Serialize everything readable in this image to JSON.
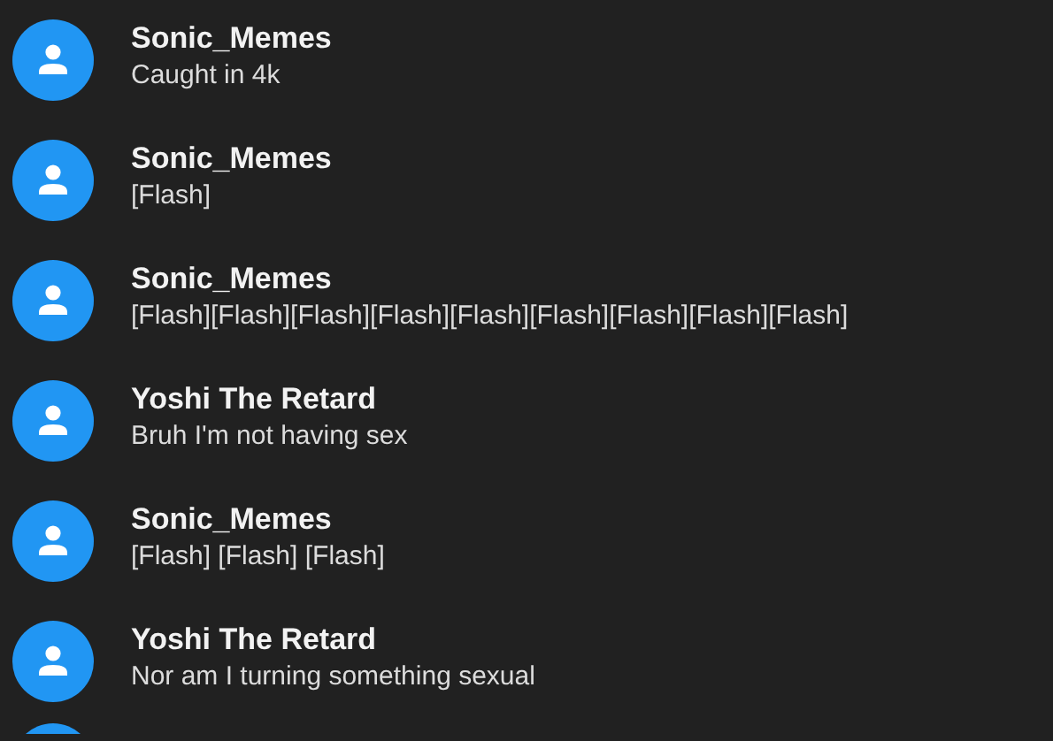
{
  "messages": [
    {
      "author": "Sonic_Memes",
      "text": "Caught in 4k"
    },
    {
      "author": "Sonic_Memes",
      "text": "[Flash]"
    },
    {
      "author": "Sonic_Memes",
      "text": "[Flash][Flash][Flash][Flash][Flash][Flash][Flash][Flash][Flash]"
    },
    {
      "author": "Yoshi The Retard",
      "text": "Bruh I'm not having sex"
    },
    {
      "author": "Sonic_Memes",
      "text": "[Flash] [Flash] [Flash]"
    },
    {
      "author": "Yoshi The Retard",
      "text": "Nor am I turning something sexual"
    }
  ]
}
